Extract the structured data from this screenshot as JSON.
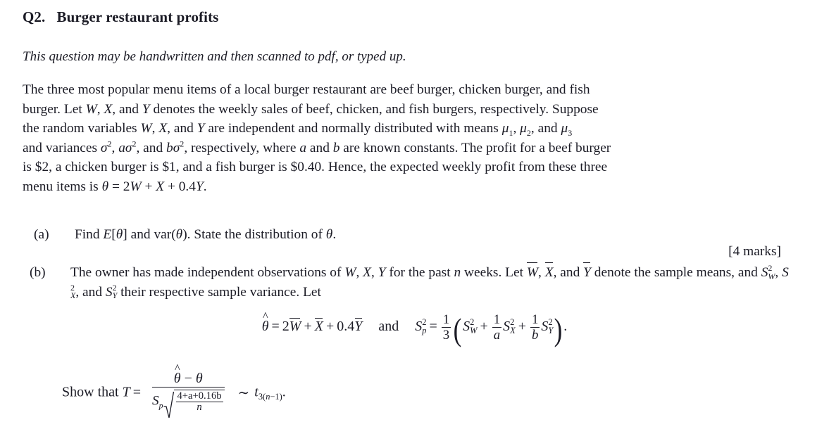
{
  "document": {
    "question_number": "Q2.",
    "question_title": "Burger restaurant profits",
    "instruction_note": "This question may be handwritten and then scanned to pdf, or typed up.",
    "background_color": "#ffffff",
    "text_color": "#1b1b25"
  },
  "intro_paragraph": {
    "line1": "The three most popular menu items of a local burger restaurant are beef burger, chicken burger, and fish",
    "line2_a": "burger. Let ",
    "line2_vars": "W, X, and Y",
    "line2_b": " denotes the weekly sales of beef, chicken, and fish burgers, respectively. Suppose",
    "line3_a": "the random variables ",
    "line3_vars": "W, X, and Y",
    "line3_b": " are independent and normally distributed with means ",
    "line3_means": "μ1, μ2, and μ3",
    "line4_a": "and variances ",
    "line4_vars": "σ², aσ², and bσ²",
    "line4_b": ", respectively, where a and b are known constants. The profit for a beef burger",
    "line5": "is $2, a chicken burger is $1, and a fish burger is $0.40.  Hence, the expected weekly profit from these three",
    "line6_a": "menu items is ",
    "line6_eq": "θ = 2W + X + 0.4Y."
  },
  "parts": {
    "a": {
      "label": "(a)",
      "text_1": "Find ",
      "text_2": "E[θ]",
      "text_3": " and ",
      "text_4": "var(θ)",
      "text_5": ". State the distribution of ",
      "text_6": "θ",
      "text_7": ".",
      "marks": "[4 marks]"
    },
    "b": {
      "label": "(b)",
      "line1_a": "The owner has made independent observations of ",
      "line1_vars": "W, X, Y",
      "line1_b": " for the past ",
      "line1_n": "n",
      "line1_c": " weeks. Let ",
      "line1_means": "W̅, X̅, and Y̅",
      "line2_a": "denote the sample means, and ",
      "line2_vars": "S²_W, S²_X, and S²_Y",
      "line2_b": " their respective sample variance. Let"
    }
  },
  "equation_1": {
    "lhs_symbol": "θ̂",
    "lhs_rhs": "= 2W̅ + X̅ + 0.4Y̅",
    "conjunction": "and",
    "rhs_symbol": "S²_p",
    "rhs_equals": "=",
    "fraction_num": "1",
    "fraction_den": "3",
    "group_term_1": "S²_W",
    "group_plus_1": "+",
    "group_frac1_num": "1",
    "group_frac1_den": "a",
    "group_term_2": "S²_X",
    "group_plus_2": "+",
    "group_frac2_num": "1",
    "group_frac2_den": "b",
    "group_term_3": "S²_Y",
    "terminator": "."
  },
  "equation_2": {
    "lead_text": "Show that",
    "t_symbol": "T",
    "equals": "=",
    "numerator": "θ̂ − θ",
    "den_sp": "S_p",
    "den_sqrt_num": "4+a+0.16b",
    "den_sqrt_den": "n",
    "distributed_as": "∼",
    "distribution": "t_{3(n−1)}",
    "terminator": "."
  }
}
